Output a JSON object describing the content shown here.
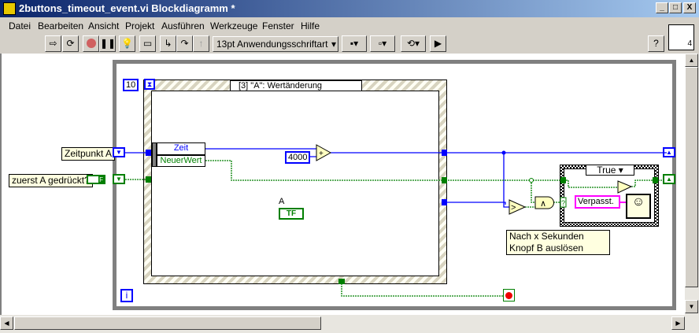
{
  "window": {
    "title": "2buttons_timeout_event.vi Blockdiagramm *",
    "controls": [
      "_",
      "□",
      "X"
    ]
  },
  "menu": [
    "Datei",
    "Bearbeiten",
    "Ansicht",
    "Projekt",
    "Ausführen",
    "Werkzeuge",
    "Fenster",
    "Hilfe"
  ],
  "toolbar": {
    "font": "13pt Anwendungsschriftart",
    "help": "?"
  },
  "connector_pane": {
    "number": "4"
  },
  "diagram": {
    "timeout_constant": "10",
    "event_case": "[3] \"A\": Wertänderung",
    "event_data": [
      "Zeit",
      "NeuerWert"
    ],
    "add_constant": "4000",
    "control_label": "A",
    "bool_terminal": "TF",
    "label_zeitpunkt": "Zeitpunkt A",
    "label_zuerst": "zuerst A gedrückt?",
    "init_bool": "F",
    "case_selector": "True",
    "string_constant": "Verpasst.",
    "comment": "Nach x Sekunden Knopf B auslösen",
    "iteration": "i",
    "and_symbol": "∧",
    "gt_symbol": ">",
    "add_symbol": "+",
    "selector_symbol": "?"
  },
  "colors": {
    "numeric": "#0000ff",
    "boolean": "#007f00",
    "string": "#ff00ff",
    "structure": "#808080"
  }
}
